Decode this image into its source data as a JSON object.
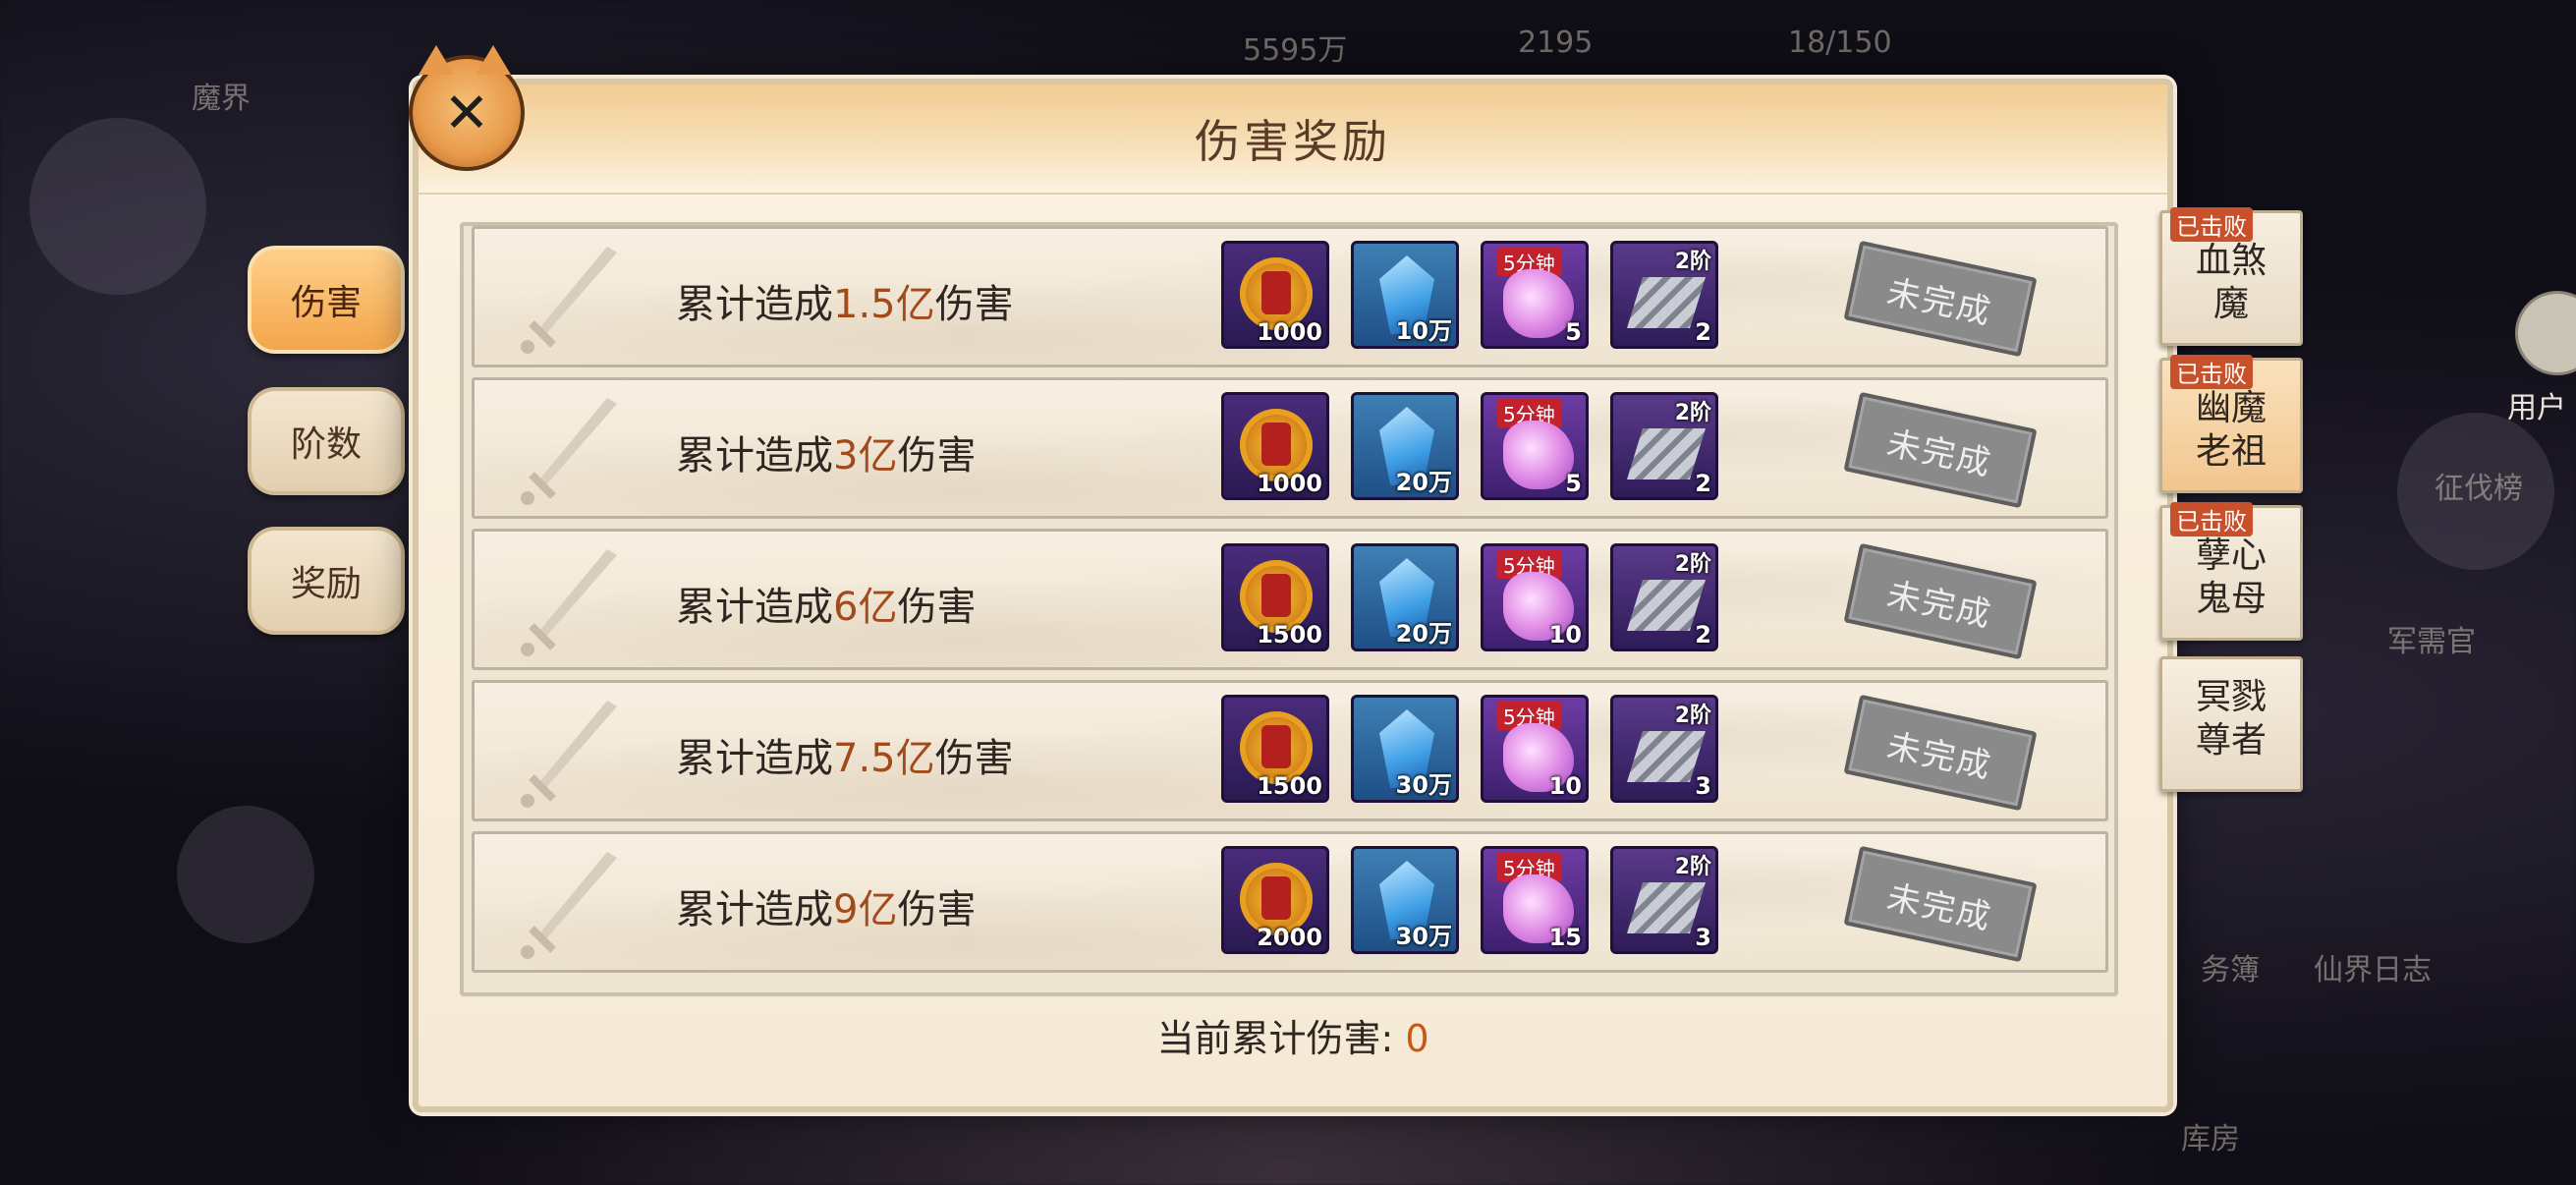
{
  "title": "伤害奖励",
  "left_tabs": [
    {
      "label": "伤害",
      "active": true
    },
    {
      "label": "阶数",
      "active": false
    },
    {
      "label": "奖励",
      "active": false
    }
  ],
  "row_prefix": "累计造成",
  "row_suffix": "伤害",
  "status_label": "未完成",
  "rows": [
    {
      "amount": "1.5亿",
      "items": [
        "1000",
        "10万",
        "5",
        "2"
      ]
    },
    {
      "amount": "3亿",
      "items": [
        "1000",
        "20万",
        "5",
        "2"
      ]
    },
    {
      "amount": "6亿",
      "items": [
        "1500",
        "20万",
        "10",
        "2"
      ]
    },
    {
      "amount": "7.5亿",
      "items": [
        "1500",
        "30万",
        "10",
        "3"
      ]
    },
    {
      "amount": "9亿",
      "items": [
        "2000",
        "30万",
        "15",
        "3"
      ]
    }
  ],
  "item_tags": {
    "pink_ribbon": "5分钟",
    "silver_tag": "2阶"
  },
  "icons": [
    "gold-emblem-icon",
    "blue-crystal-icon",
    "pink-orb-icon",
    "silver-ingot-icon",
    "sword-icon"
  ],
  "total": {
    "label": "当前累计伤害:",
    "value": "0"
  },
  "bosses": [
    {
      "line1": "血煞",
      "line2": "魔",
      "defeated": "已击败"
    },
    {
      "line1": "幽魔",
      "line2": "老祖",
      "defeated": "已击败"
    },
    {
      "line1": "孽心",
      "line2": "鬼母",
      "defeated": "已击败"
    },
    {
      "line1": "冥戮",
      "line2": "尊者",
      "defeated": ""
    }
  ],
  "background_text": [
    "魔界",
    "务簿",
    "仙界日志",
    "军需官",
    "征伐榜",
    "库房",
    "用户",
    "18/150",
    "5595万",
    "2195"
  ],
  "colors": {
    "amount": "#a34a1a",
    "total_value": "#c45a16",
    "active_tab": "#f3a54a"
  }
}
